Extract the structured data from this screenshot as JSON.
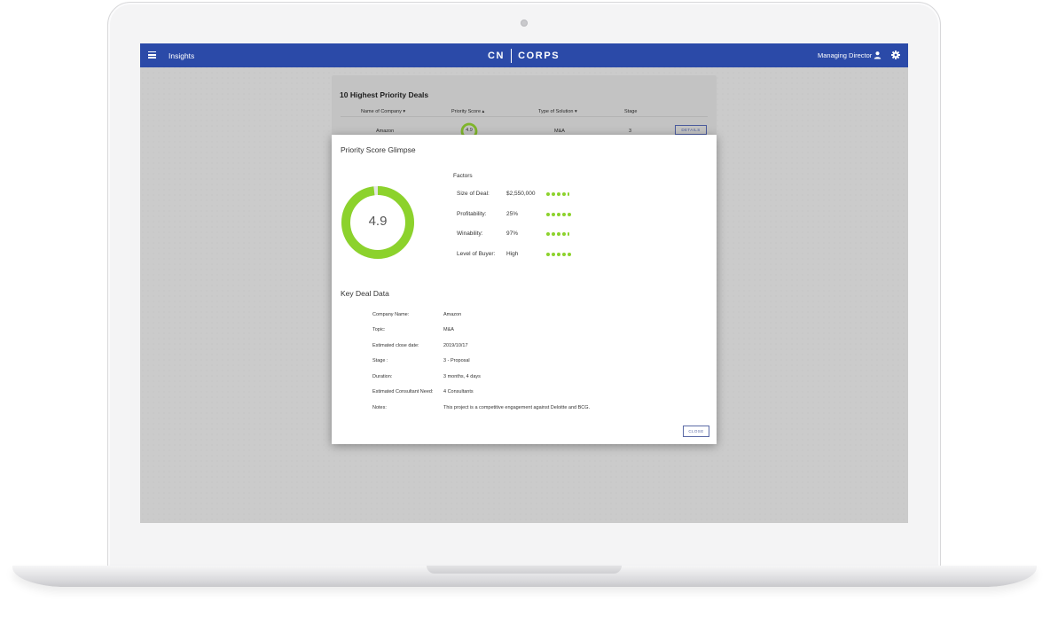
{
  "app": {
    "menu_icon": "hamburger-menu-icon",
    "title": "Insights",
    "logo_left": "CN",
    "logo_right": "CORPS",
    "role": "Managing Director",
    "user_icon": "person-icon",
    "settings_icon": "gear-icon",
    "bar_color": "#2b4aa8"
  },
  "table": {
    "title": "10 Highest Priority Deals",
    "headers": [
      "Name of Company ▾",
      "Priority Score ▴",
      "Type of Solution ▾",
      "Stage"
    ],
    "row": {
      "company": "Amazon",
      "score": "4.9",
      "solution": "M&A",
      "stage": "3",
      "details": "DETAILS"
    }
  },
  "modal": {
    "title": "Priority Score Glimpse",
    "score": "4.9",
    "score_fraction": 0.98,
    "accent": "#8cd22c",
    "factors_title": "Factors",
    "factors": [
      {
        "label": "Size of Deal:",
        "value": "$2,550,000",
        "rating": 4.5
      },
      {
        "label": "Profitability:",
        "value": "25%",
        "rating": 5
      },
      {
        "label": "Winability:",
        "value": "97%",
        "rating": 4.5
      },
      {
        "label": "Level of Buyer:",
        "value": "High",
        "rating": 5
      }
    ],
    "key_deal_title": "Key Deal Data",
    "key_deal": [
      {
        "label": "Company Name:",
        "value": "Amazon"
      },
      {
        "label": "Topic:",
        "value": "M&A"
      },
      {
        "label": "Estimated close date:",
        "value": "2019/10/17"
      },
      {
        "label": "Stage :",
        "value": "3 - Proposal"
      },
      {
        "label": "Duration:",
        "value": "3 months, 4 days"
      },
      {
        "label": "Estimated Consultant Need:",
        "value": "4 Consultants"
      },
      {
        "label": "Notes:",
        "value": "This project is a competitive engagement against Deloitte and BCG."
      }
    ],
    "close_label": "CLOSE"
  }
}
